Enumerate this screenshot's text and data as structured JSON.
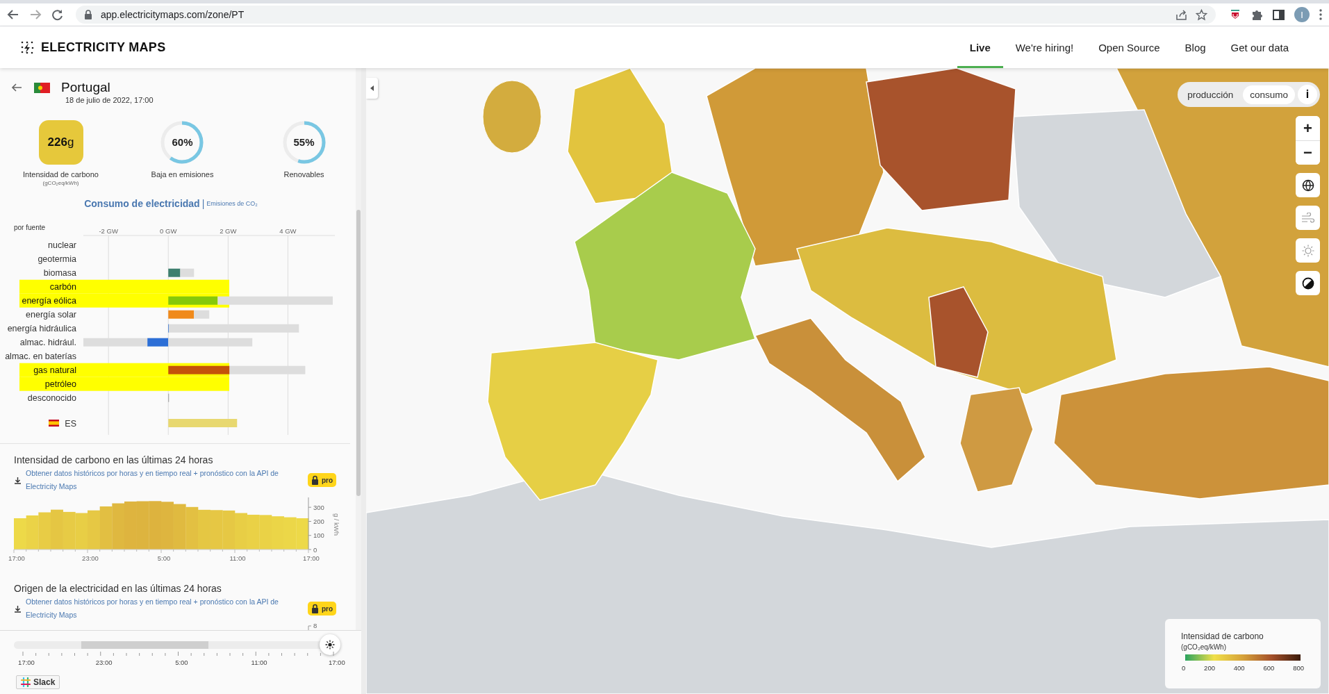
{
  "browser": {
    "url": "app.electricitymaps.com/zone/PT",
    "avatar": "I"
  },
  "header": {
    "logo": "ELECTRICITY MAPS",
    "nav": [
      {
        "label": "Live",
        "selected": true
      },
      {
        "label": "We're hiring!",
        "selected": false
      },
      {
        "label": "Open Source",
        "selected": false
      },
      {
        "label": "Blog",
        "selected": false
      },
      {
        "label": "Get our data",
        "selected": false
      }
    ]
  },
  "zone": {
    "name": "Portugal",
    "datetime": "18 de julio de 2022, 17:00"
  },
  "metrics": [
    {
      "kind": "square",
      "value": "**226**g",
      "label": "Intensidad de carbono",
      "sublabel": "(gCO₂eq/kWh)"
    },
    {
      "kind": "ring",
      "value": "60%",
      "label": "Baja en emisiones",
      "level": 0.6
    },
    {
      "kind": "ring",
      "value": "55%",
      "label": "Renovables",
      "level": 0.55
    }
  ],
  "breakdown": {
    "tabs": [
      {
        "label": "Consumo de electricidad",
        "selected": true
      },
      {
        "label": "Emisiones de CO₂",
        "selected": false
      }
    ],
    "separator": "|",
    "axis_title": "por fuente",
    "row_marks": [
      {
        "kind": "source",
        "highlighted": false
      },
      {
        "kind": "source",
        "highlighted": false
      },
      {
        "kind": "source",
        "highlighted": false
      },
      {
        "kind": "source",
        "highlighted": true
      },
      {
        "kind": "source",
        "highlighted": true
      },
      {
        "kind": "source",
        "highlighted": false
      },
      {
        "kind": "source",
        "highlighted": false
      },
      {
        "kind": "source",
        "highlighted": false
      },
      {
        "kind": "source",
        "highlighted": false
      },
      {
        "kind": "source",
        "highlighted": true
      },
      {
        "kind": "source",
        "highlighted": true
      },
      {
        "kind": "source",
        "highlighted": false
      },
      {
        "kind": "exchange",
        "highlighted": false
      }
    ],
    "chart_data": {
      "type": "bar",
      "orientation": "horizontal",
      "stacked": true,
      "grid": true,
      "categories": [
        "nuclear",
        "geotermia",
        "biomasa",
        "carbón",
        "energía eólica",
        "energía solar",
        "energía hidráulica",
        "almac. hidrául.",
        "almac. en baterías",
        "gas natural",
        "petróleo",
        "desconocido",
        "ES"
      ],
      "xlim": [
        -2.84,
        5.5
      ],
      "xticks": [
        {
          "value": -2,
          "label": "-2 GW"
        },
        {
          "value": 0,
          "label": "0 GW"
        },
        {
          "value": 2,
          "label": "2 GW"
        },
        {
          "value": 4,
          "label": "4 GW"
        }
      ],
      "series": [
        {
          "colors": [
            null,
            null,
            "#3d7f6e",
            null,
            "#86c80a",
            "#f08a1c",
            "#2f6fd0",
            "#2d6fd6",
            null,
            "#c4530a",
            null,
            "#999999",
            "#e8d870"
          ],
          "values": [
            null,
            null,
            0.4,
            null,
            1.65,
            0.86,
            0.02,
            -0.7,
            null,
            2.05,
            null,
            0.01,
            2.3
          ]
        },
        {
          "color": "#dddddd",
          "values": [
            null,
            null,
            0.46,
            null,
            3.85,
            0.51,
            4.35,
            2.81,
            null,
            2.53,
            null,
            null,
            null
          ]
        },
        {
          "color": "#dddddd",
          "values": [
            null,
            null,
            null,
            null,
            null,
            null,
            null,
            -2.14,
            null,
            null,
            null,
            null,
            null
          ]
        }
      ]
    }
  },
  "carbon_history": {
    "axis_end_label": "17:00",
    "title": "Intensidad de carbono en las últimas 24 horas",
    "link": "Obtener datos históricos por horas y en tiempo real + pronóstico con la API de Electricity Maps",
    "badge": "pro",
    "chart_data": {
      "type": "bar",
      "ylabel": "g / kWh",
      "ylim": [
        0,
        380
      ],
      "yticks": [
        0,
        100,
        200,
        300
      ],
      "categories": [
        "17:00",
        null,
        null,
        null,
        null,
        null,
        "23:00",
        null,
        null,
        null,
        null,
        null,
        "5:00",
        null,
        null,
        null,
        null,
        null,
        "11:00",
        null,
        null,
        null,
        null,
        null
      ],
      "values": [
        222,
        242,
        264,
        283,
        267,
        259,
        278,
        306,
        328,
        341,
        343,
        344,
        339,
        323,
        302,
        282,
        280,
        277,
        259,
        247,
        245,
        236,
        229,
        222
      ]
    }
  },
  "origin_history": {
    "title": "Origen de la electricidad en las últimas 24 horas",
    "link": "Obtener datos históricos por horas y en tiempo real + pronóstico con la API de Electricity Maps",
    "badge": "pro",
    "tick": "8"
  },
  "timeline": {
    "level": 1,
    "ticks": [
      "17:00",
      "23:00",
      "5:00",
      "11:00",
      "17:00"
    ]
  },
  "slack": "Slack",
  "map": {
    "toggle": [
      {
        "label": "producción",
        "selected": false
      },
      {
        "label": "consumo",
        "selected": true
      }
    ],
    "info": "i",
    "zoom_in": "+",
    "zoom_out": "−",
    "legend": {
      "title": "Intensidad de carbono",
      "unit": "(gCO₂eq/kWh)",
      "ticks": [
        "0",
        "200",
        "400",
        "600",
        "800"
      ]
    }
  }
}
